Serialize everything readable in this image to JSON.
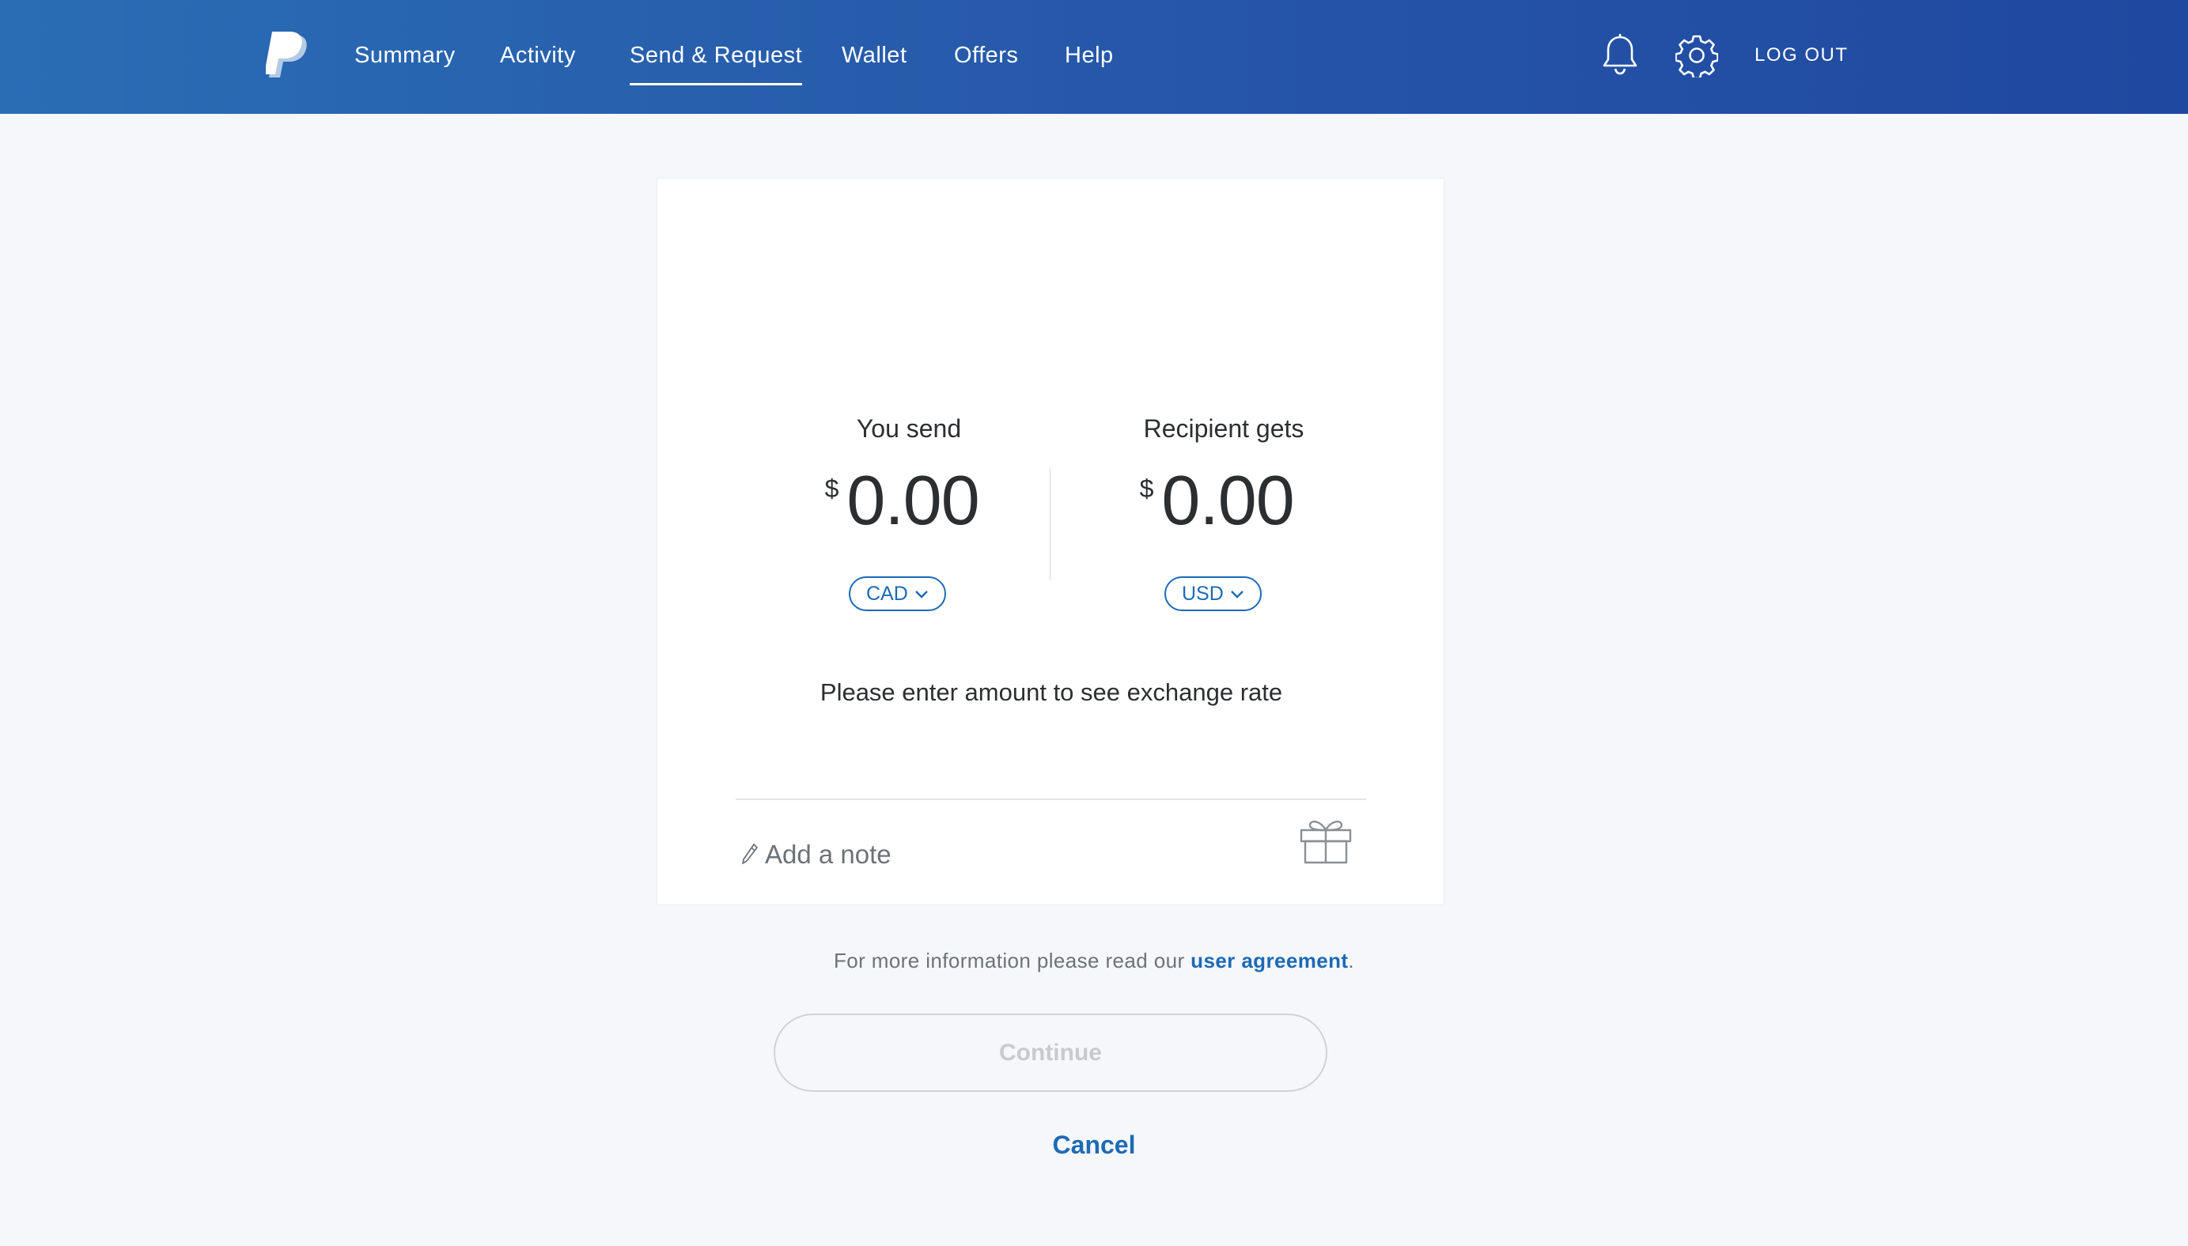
{
  "header": {
    "logo": "paypal-logo",
    "nav": [
      {
        "label": "Summary",
        "active": false
      },
      {
        "label": "Activity",
        "active": false
      },
      {
        "label": "Send & Request",
        "active": true
      },
      {
        "label": "Wallet",
        "active": false
      },
      {
        "label": "Offers",
        "active": false
      },
      {
        "label": "Help",
        "active": false
      }
    ],
    "icons": [
      "bell-icon",
      "gear-icon"
    ],
    "logout_label": "LOG OUT"
  },
  "transfer": {
    "send": {
      "label": "You send",
      "currency_symbol": "$",
      "amount": "0.00",
      "currency": "CAD"
    },
    "receive": {
      "label": "Recipient gets",
      "currency_symbol": "$",
      "amount": "0.00",
      "currency": "USD"
    },
    "rate_message": "Please enter amount to see exchange rate",
    "note_placeholder": "Add a note"
  },
  "footer": {
    "agreement_prefix": "For more information please read our ",
    "agreement_link": "user agreement",
    "agreement_suffix": ".",
    "continue_label": "Continue",
    "cancel_label": "Cancel"
  },
  "colors": {
    "header_gradient_start": "#2a6db5",
    "header_gradient_end": "#1f48a0",
    "accent": "#1d6ab5",
    "page_background": "#f5f7fa",
    "disabled_text": "#c8cacc"
  }
}
